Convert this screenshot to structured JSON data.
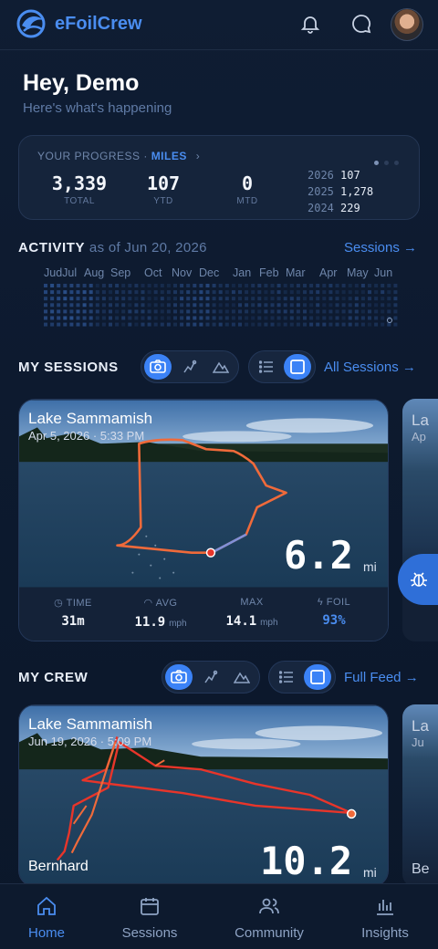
{
  "app": {
    "brand": "eFoilCrew"
  },
  "header": {
    "greeting": "Hey, Demo",
    "subtitle": "Here's what's happening"
  },
  "progress": {
    "title_prefix": "YOUR PROGRESS · ",
    "unit": "MILES",
    "chevron": "›",
    "page_dots": 3,
    "stats": [
      {
        "value": "3,339",
        "label": "TOTAL"
      },
      {
        "value": "107",
        "label": "YTD"
      },
      {
        "value": "0",
        "label": "MTD"
      }
    ],
    "years": [
      {
        "year": "2026",
        "value": "107"
      },
      {
        "year": "2025",
        "value": "1,278"
      },
      {
        "year": "2024",
        "value": "229"
      }
    ]
  },
  "activity": {
    "title": "ACTIVITY",
    "as_of": "as of Jun 20, 2026",
    "link": "Sessions →",
    "months": [
      "Jul",
      "Aug",
      "Sep",
      "Oct",
      "Nov",
      "Dec",
      "Jan",
      "Feb",
      "Mar",
      "Apr",
      "May",
      "Jun"
    ],
    "months_prefix": "Jud"
  },
  "my_sessions": {
    "title": "MY SESSIONS",
    "link": "All Sessions →",
    "card": {
      "location": "Lake Sammamish",
      "date": "Apr 5, 2026 · 5:33 PM",
      "distance": "6.2",
      "unit": "mi",
      "stats": [
        {
          "icon": "clock-icon",
          "label": "TIME",
          "value": "31m",
          "unit": ""
        },
        {
          "icon": "speedometer-icon",
          "label": "AVG",
          "value": "11.9",
          "unit": "mph"
        },
        {
          "icon": "",
          "label": "MAX",
          "value": "14.1",
          "unit": "mph"
        },
        {
          "icon": "lightning-icon",
          "label": "FOIL",
          "value": "93%",
          "unit": ""
        }
      ]
    },
    "peek": {
      "location": "La",
      "date": "Ap"
    }
  },
  "my_crew": {
    "title": "MY CREW",
    "link": "Full Feed →",
    "card": {
      "location": "Lake Sammamish",
      "date": "Jun 19, 2026 · 5:09 PM",
      "rider": "Bernhard",
      "distance": "10.2",
      "unit": "mi"
    },
    "peek": {
      "location": "La",
      "date": "Ju",
      "rider": "Be"
    }
  },
  "nav": [
    {
      "label": "Home",
      "icon": "home-icon",
      "active": true
    },
    {
      "label": "Sessions",
      "icon": "calendar-icon",
      "active": false
    },
    {
      "label": "Community",
      "icon": "users-icon",
      "active": false
    },
    {
      "label": "Insights",
      "icon": "bar-chart-icon",
      "active": false
    }
  ],
  "colors": {
    "accent": "#4a8df0",
    "active_toggle": "#3b82f6",
    "track_orange": "#f06a3a",
    "track_red": "#e8352a"
  }
}
